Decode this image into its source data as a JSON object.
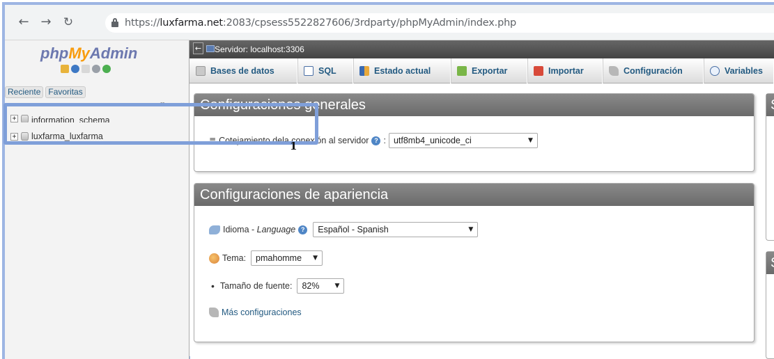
{
  "browser": {
    "url_scheme": "https://",
    "url_host": "luxfarma.net",
    "url_rest": ":2083/cpsess5522827606/3rdparty/phpMyAdmin/index.php",
    "back_icon": "arrow-left-icon",
    "forward_icon": "arrow-right-icon",
    "reload_icon": "reload-icon"
  },
  "sidebar": {
    "logo_php": "php",
    "logo_my": "My",
    "logo_admin": "Admin",
    "recent_label": "Reciente",
    "favorites_label": "Favoritas",
    "databases": [
      {
        "name": "information_schema"
      },
      {
        "name": "luxfarma_luxfarma"
      }
    ]
  },
  "server": {
    "label": "Servidor: localhost:3306"
  },
  "menu": [
    {
      "label": "Bases de datos",
      "icon": "database-icon"
    },
    {
      "label": "SQL",
      "icon": "sql-icon"
    },
    {
      "label": "Estado actual",
      "icon": "status-chart-icon"
    },
    {
      "label": "Exportar",
      "icon": "export-icon"
    },
    {
      "label": "Importar",
      "icon": "import-icon"
    },
    {
      "label": "Configuración",
      "icon": "wrench-icon"
    },
    {
      "label": "Variables",
      "icon": "variables-icon"
    }
  ],
  "general_settings": {
    "title": "Configuraciones generales",
    "collation_label_part1": "Cotejamiento de",
    "collation_label_part2": "la co",
    "collation_label_part3": "nexión al servidor",
    "collation_colon": ":",
    "collation_value": "utf8mb4_unicode_ci"
  },
  "appearance_settings": {
    "title": "Configuraciones de apariencia",
    "language_label": "Idioma - ",
    "language_label_en": "Language",
    "language_value": "Español - Spanish",
    "theme_label": "Tema:",
    "theme_value": "pmahomme",
    "font_size_label": "Tamaño de fuente:",
    "font_size_value": "82%",
    "more_settings": "Más configuraciones"
  },
  "right_panels": [
    {
      "head": "S"
    },
    {
      "head": "S"
    }
  ],
  "annotation": {
    "number": "1"
  }
}
